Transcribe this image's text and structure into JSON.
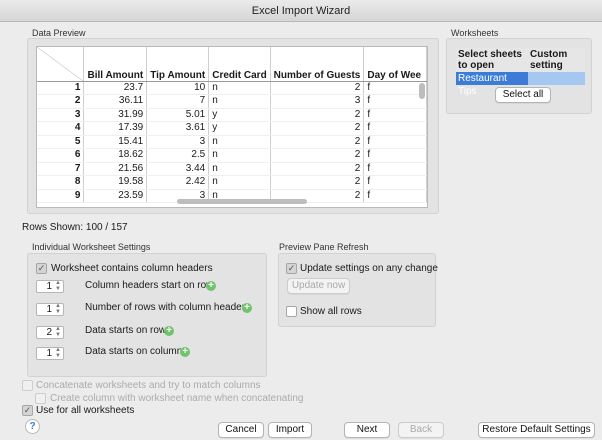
{
  "window": {
    "title": "Excel Import Wizard"
  },
  "data_preview": {
    "label": "Data Preview",
    "columns": [
      "Bill Amount",
      "Tip Amount",
      "Credit Card",
      "Number of Guests",
      "Day of Wee"
    ],
    "rows": [
      [
        "1",
        "23.7",
        "10",
        "n",
        "2",
        "f"
      ],
      [
        "2",
        "36.11",
        "7",
        "n",
        "3",
        "f"
      ],
      [
        "3",
        "31.99",
        "5.01",
        "y",
        "2",
        "f"
      ],
      [
        "4",
        "17.39",
        "3.61",
        "y",
        "2",
        "f"
      ],
      [
        "5",
        "15.41",
        "3",
        "n",
        "2",
        "f"
      ],
      [
        "6",
        "18.62",
        "2.5",
        "n",
        "2",
        "f"
      ],
      [
        "7",
        "21.56",
        "3.44",
        "n",
        "2",
        "f"
      ],
      [
        "8",
        "19.58",
        "2.42",
        "n",
        "2",
        "f"
      ],
      [
        "9",
        "23.59",
        "3",
        "n",
        "2",
        "f"
      ]
    ],
    "rows_shown": "Rows Shown: 100 / 157"
  },
  "worksheets": {
    "label": "Worksheets",
    "col_select": "Select sheets to open",
    "col_custom": "Custom setting",
    "items": [
      "Restaurant Tips"
    ],
    "select_all": "Select all"
  },
  "individual": {
    "label": "Individual Worksheet Settings",
    "headers_checkbox": "Worksheet contains column headers",
    "header_start_value": "1",
    "header_start_label": "Column headers start on row",
    "header_rows_value": "1",
    "header_rows_label": "Number of rows with column headers",
    "data_row_value": "2",
    "data_row_label": "Data starts on row",
    "data_col_value": "1",
    "data_col_label": "Data starts on column"
  },
  "preview_refresh": {
    "label": "Preview Pane Refresh",
    "update_checkbox": "Update settings on any change",
    "update_now": "Update now",
    "show_all_rows": "Show all rows"
  },
  "options": {
    "concatenate": "Concatenate worksheets and try to match columns",
    "create_column": "Create column with worksheet name when concatenating",
    "use_for_all": "Use for all worksheets"
  },
  "footer": {
    "help": "?",
    "cancel": "Cancel",
    "import": "Import",
    "next": "Next",
    "back": "Back",
    "restore": "Restore Default Settings"
  }
}
